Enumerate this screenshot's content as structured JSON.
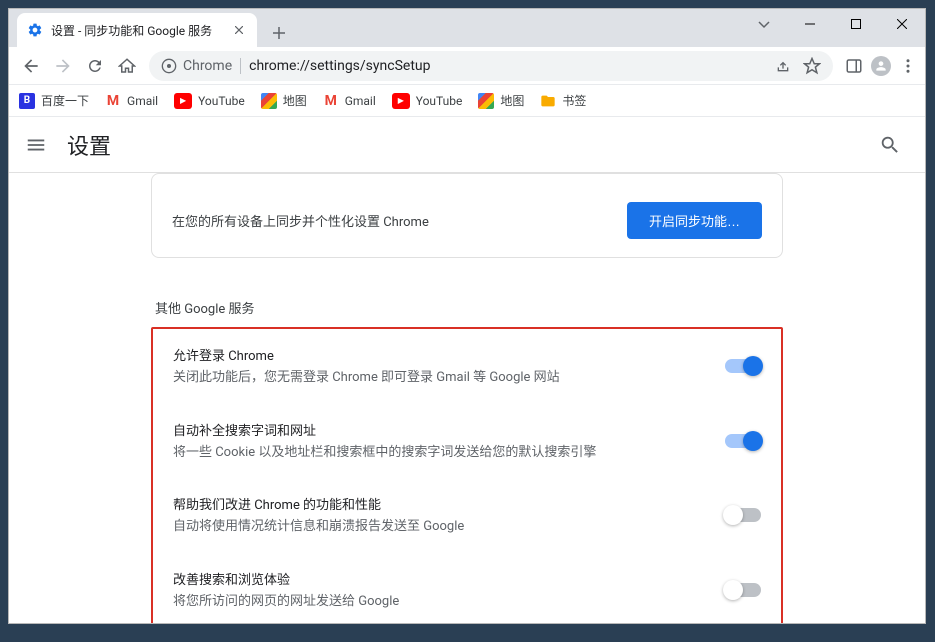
{
  "window": {
    "tab_title": "设置 - 同步功能和 Google 服务"
  },
  "address": {
    "site_label": "Chrome",
    "url": "chrome://settings/syncSetup"
  },
  "bookmarks": {
    "items": [
      {
        "label": "百度一下",
        "icon": "baidu"
      },
      {
        "label": "Gmail",
        "icon": "gmail"
      },
      {
        "label": "YouTube",
        "icon": "youtube"
      },
      {
        "label": "地图",
        "icon": "maps"
      },
      {
        "label": "Gmail",
        "icon": "gmail"
      },
      {
        "label": "YouTube",
        "icon": "youtube"
      },
      {
        "label": "地图",
        "icon": "maps"
      },
      {
        "label": "书签",
        "icon": "folder"
      }
    ]
  },
  "header": {
    "title": "设置"
  },
  "sync_card": {
    "description": "在您的所有设备上同步并个性化设置 Chrome",
    "button_label": "开启同步功能…"
  },
  "section": {
    "title": "其他 Google 服务"
  },
  "settings": [
    {
      "title": "允许登录 Chrome",
      "desc": "关闭此功能后，您无需登录 Chrome 即可登录 Gmail 等 Google 网站",
      "enabled": true
    },
    {
      "title": "自动补全搜索字词和网址",
      "desc": "将一些 Cookie 以及地址栏和搜索框中的搜索字词发送给您的默认搜索引擎",
      "enabled": true
    },
    {
      "title": "帮助我们改进 Chrome 的功能和性能",
      "desc": "自动将使用情况统计信息和崩溃报告发送至 Google",
      "enabled": false
    },
    {
      "title": "改善搜索和浏览体验",
      "desc": "将您所访问的网页的网址发送给 Google",
      "enabled": false
    }
  ]
}
